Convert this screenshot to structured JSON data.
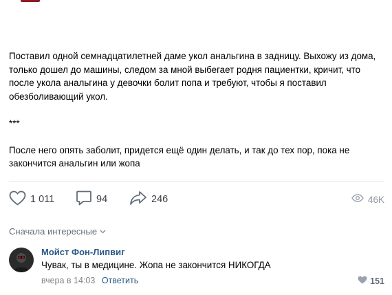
{
  "post": {
    "paragraphs": [
      "Поставил одной семнадцатилетней даме укол анальгина в задницу. Выхожу из дома, только дошел до машины, следом за мной выбегает родня пациентки, кричит, что после укола анальгина у девочки болит попа и требуют, чтобы я поставил обезболивающий укол.",
      "***",
      "После него опять заболит, придется ещё один делать, и так до тех пор, пока не закончится анальгин или жопа"
    ]
  },
  "actions": {
    "likes": "1 011",
    "comments": "94",
    "shares": "246",
    "views": "46K"
  },
  "comments_section": {
    "sort_label": "Сначала интересные",
    "items": [
      {
        "author": "Мойст Фон-Липвиг",
        "text": "Чувак, ты в медицине. Жопа не закончится НИКОГДА",
        "time": "вчера в 14:03",
        "reply_label": "Ответить",
        "likes": "151"
      }
    ]
  },
  "icons": {
    "like": "heart-icon",
    "comment": "comment-bubble-icon",
    "share": "share-arrow-icon",
    "views": "eye-icon",
    "sort": "chevron-down-icon"
  },
  "colors": {
    "link": "#2a5885",
    "meta": "#828282",
    "icon": "#626d7a",
    "divider": "#e7e8ec"
  }
}
